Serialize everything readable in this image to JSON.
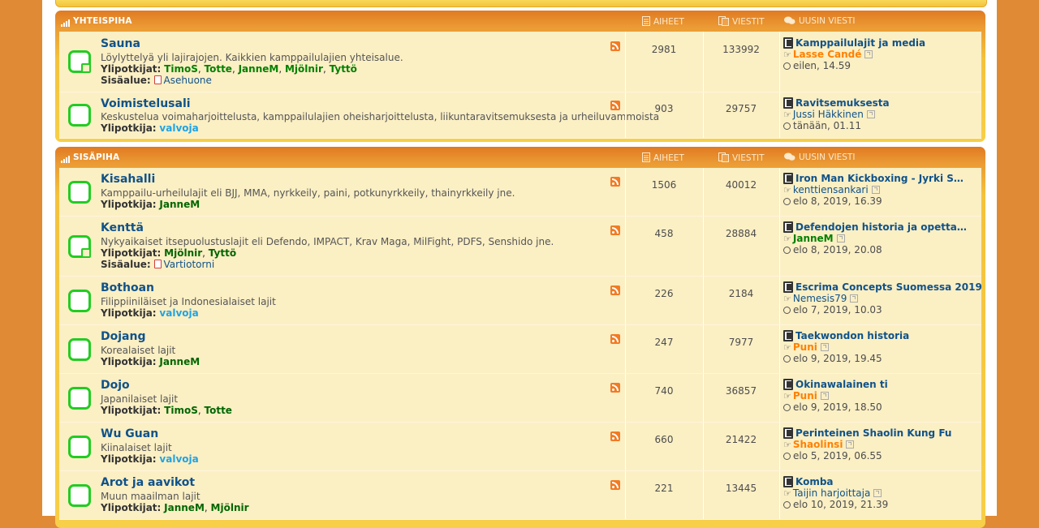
{
  "colors": {
    "background": "#e08a35",
    "header_gradient_top": "#e07a22",
    "row_bg": "#fbefc4",
    "forum_title": "#105289",
    "icon_green": "#22cc22",
    "moderator_green": "#008000",
    "moderator_blue": "#1fa3e5",
    "user_orange": "#ff8000",
    "rss_orange": "#f27b23"
  },
  "columns": {
    "topics": "AIHEET",
    "posts": "VIESTIT",
    "last_post": "UUSIN VIESTI"
  },
  "categories": [
    {
      "title": "YHTEISPIHA",
      "forums": [
        {
          "name": "Sauna",
          "description": "Löylyttelyä yli lajirajojen. Kaikkien kamppailulajien yhteisalue.",
          "moderators_label": "Ylipotkijat:",
          "moderators": [
            "TimoS",
            "Totte",
            "JanneM",
            "Mjölnir",
            "Tyttö"
          ],
          "subforum_label": "Sisäalue:",
          "subforum": "Asehuone",
          "topics": "2981",
          "posts": "133992",
          "last_title": "Kamppailulajit ja media",
          "last_user": "Lasse Candé",
          "last_time": "eilen, 14.59"
        },
        {
          "name": "Voimistelusali",
          "description": "Keskustelua voimaharjoittelusta, kamppailulajien oheisharjoittelusta, liikuntaravitsemuksesta ja urheiluvammoista",
          "moderators_label": "Ylipotkija:",
          "moderators": [
            "valvoja"
          ],
          "topics": "903",
          "posts": "29757",
          "last_title": "Ravitsemuksesta",
          "last_user": "Jussi Häkkinen",
          "last_time": "tänään, 01.11"
        }
      ]
    },
    {
      "title": "SISÄPIHA",
      "forums": [
        {
          "name": "Kisahalli",
          "description": "Kamppailu-urheilulajit eli BJJ, MMA, nyrkkeily, paini, potkunyrkkeily, thainyrkkeily jne.",
          "moderators_label": "Ylipotkija:",
          "moderators": [
            "JanneM"
          ],
          "topics": "1506",
          "posts": "40012",
          "last_title": "Iron Man Kickboxing - Jyrki S…",
          "last_user": "kenttiensankari",
          "last_time": "elo 8, 2019, 16.39"
        },
        {
          "name": "Kenttä",
          "description": "Nykyaikaiset itsepuolustuslajit eli Defendo, IMPACT, Krav Maga, MilFight, PDFS, Senshido jne.",
          "moderators_label": "Ylipotkijat:",
          "moderators": [
            "Mjölnir",
            "Tyttö"
          ],
          "subforum_label": "Sisäalue:",
          "subforum": "Vartiotorni",
          "topics": "458",
          "posts": "28884",
          "last_title": "Defendojen historia ja opetta…",
          "last_user": "JanneM",
          "last_time": "elo 8, 2019, 20.08"
        },
        {
          "name": "Bothoan",
          "description": "Filippiiniläiset ja Indonesialaiset lajit",
          "moderators_label": "Ylipotkija:",
          "moderators": [
            "valvoja"
          ],
          "topics": "226",
          "posts": "2184",
          "last_title": "Escrima Concepts Suomessa 2019",
          "last_user": "Nemesis79",
          "last_time": "elo 7, 2019, 10.03"
        },
        {
          "name": "Dojang",
          "description": "Korealaiset lajit",
          "moderators_label": "Ylipotkija:",
          "moderators": [
            "JanneM"
          ],
          "topics": "247",
          "posts": "7977",
          "last_title": "Taekwondon historia",
          "last_user": "Puni",
          "last_time": "elo 9, 2019, 19.45"
        },
        {
          "name": "Dojo",
          "description": "Japanilaiset lajit",
          "moderators_label": "Ylipotkijat:",
          "moderators": [
            "TimoS",
            "Totte"
          ],
          "topics": "740",
          "posts": "36857",
          "last_title": "Okinawalainen ti",
          "last_user": "Puni",
          "last_time": "elo 9, 2019, 18.50"
        },
        {
          "name": "Wu Guan",
          "description": "Kiinalaiset lajit",
          "moderators_label": "Ylipotkija:",
          "moderators": [
            "valvoja"
          ],
          "topics": "660",
          "posts": "21422",
          "last_title": "Perinteinen Shaolin Kung Fu",
          "last_user": "Shaolinsi",
          "last_time": "elo 5, 2019, 06.55"
        },
        {
          "name": "Arot ja aavikot",
          "description": "Muun maailman lajit",
          "moderators_label": "Ylipotkijat:",
          "moderators": [
            "JanneM",
            "Mjölnir"
          ],
          "topics": "221",
          "posts": "13445",
          "last_title": "Komba",
          "last_user": "Taijin harjoittaja",
          "last_time": "elo 10, 2019, 21.39"
        }
      ]
    }
  ]
}
